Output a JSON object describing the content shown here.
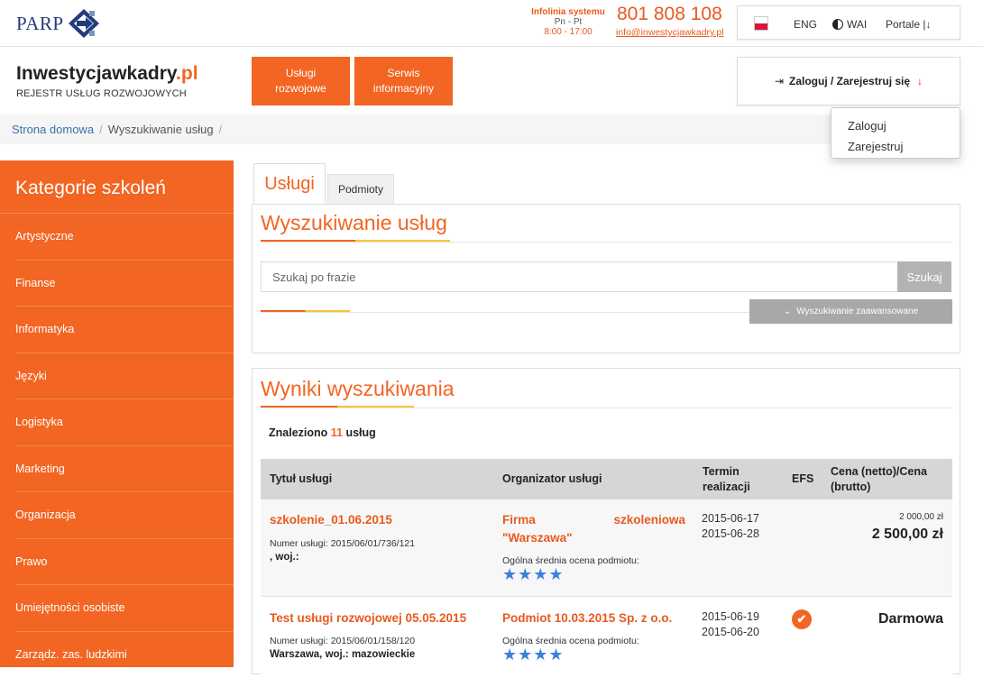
{
  "header": {
    "parp_logo": "PARP",
    "infolinia_label": "Infolinia systemu",
    "infolinia_days": "Pn - Pt",
    "infolinia_hours": "8:00 - 17:00",
    "phone": "801 808 108",
    "email": "info@inwestycjawkadry.pl",
    "lang": "ENG",
    "wai": "WAI",
    "portale": "Portale |↓",
    "site_title_main": "Inwestycjawkadry",
    "site_title_tld": ".pl",
    "site_subtitle": "REJESTR USŁUG ROZWOJOWYCH",
    "nav_uslugi": "Usługi rozwojowe",
    "nav_serwis": "Serwis informacyjny",
    "login_label": "Zaloguj / Zarejestruj się"
  },
  "breadcrumb": {
    "home": "Strona domowa",
    "current": "Wyszukiwanie usług",
    "sep": "/"
  },
  "login_menu": [
    "Zaloguj",
    "Zarejestruj"
  ],
  "sidebar": {
    "title": "Kategorie szkoleń",
    "items": [
      "Artystyczne",
      "Finanse",
      "Informatyka",
      "Języki",
      "Logistyka",
      "Marketing",
      "Organizacja",
      "Prawo",
      "Umiejętności osobiste",
      "Zarządz. zas. ludzkimi"
    ]
  },
  "tabs": {
    "uslugi": "Usługi",
    "podmioty": "Podmioty"
  },
  "search": {
    "title": "Wyszukiwanie usług",
    "placeholder": "Szukaj po frazie",
    "button": "Szukaj",
    "advanced": "Wyszukiwanie zaawansowane"
  },
  "results": {
    "title": "Wyniki wyszukiwania",
    "found_prefix": "Znaleziono",
    "found_count": "11",
    "found_suffix": "usług",
    "columns": {
      "title": "Tytuł usługi",
      "organizer": "Organizator usługi",
      "term_line1": "Termin",
      "term_line2": "realizacji",
      "efs": "EFS",
      "price_line1": "Cena (netto)/Cena",
      "price_line2": "(brutto)"
    },
    "rating_label": "Ogólna średnia ocena podmiotu:",
    "rows": [
      {
        "title": "szkolenie_01.06.2015",
        "number": "Numer usługi: 2015/06/01/736/121",
        "location": ", woj.:",
        "organizer_line1": "Firma szkoleniowa",
        "organizer_line2": "\"Warszawa\"",
        "stars": "★★★★",
        "date_start": "2015-06-17",
        "date_end": "2015-06-28",
        "efs": "",
        "price_net": "2 000,00 zł",
        "price_gross": "2 500,00 zł"
      },
      {
        "title": "Test usługi rozwojowej 05.05.2015",
        "number": "Numer usługi: 2015/06/01/158/120",
        "location": "Warszawa, woj.: mazowieckie",
        "organizer_line1": "Podmiot 10.03.2015 Sp. z o.o.",
        "stars": "★★★★",
        "date_start": "2015-06-19",
        "date_end": "2015-06-20",
        "efs": "✔",
        "price_gross": "Darmowa"
      }
    ]
  }
}
